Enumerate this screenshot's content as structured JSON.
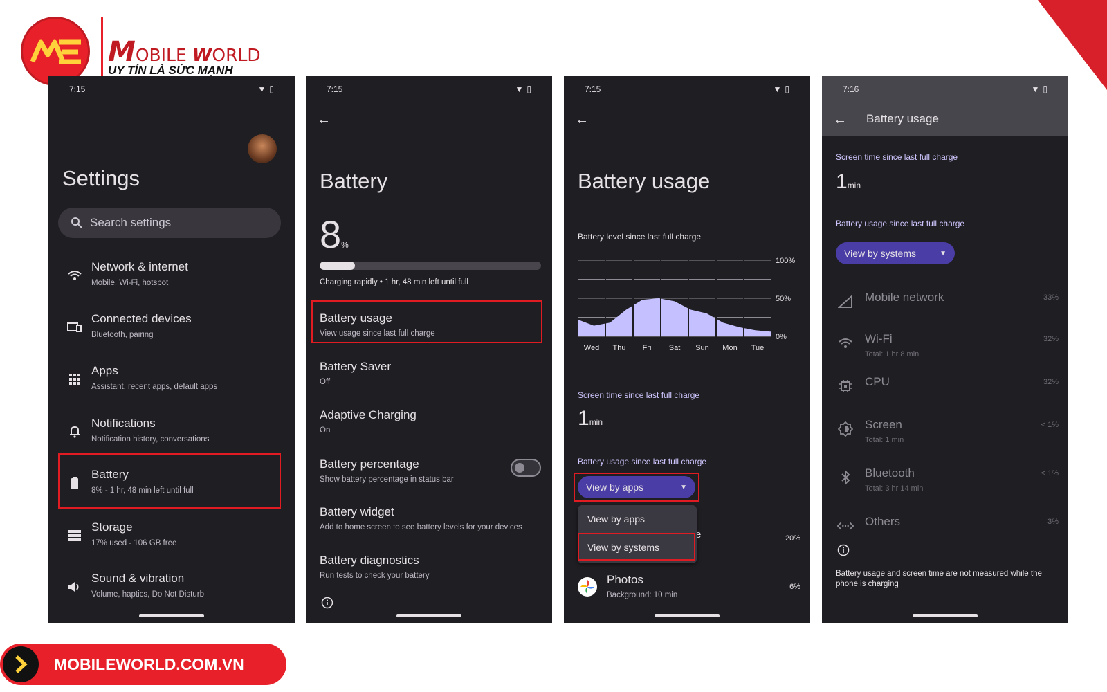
{
  "brand": {
    "name_big": "M",
    "name_rest": "OBILE",
    "name_big2": "W",
    "name_rest2": "ORLD",
    "tagline": "UY TÍN LÀ SỨC MẠNH",
    "website": "MOBILEWORLD.COM.VN",
    "colors": {
      "red": "#e8202a",
      "dark_red": "#c01b22"
    }
  },
  "screen1": {
    "time": "7:15",
    "title": "Settings",
    "search_placeholder": "Search settings",
    "items": [
      {
        "icon": "wifi-icon",
        "title": "Network & internet",
        "subtitle": "Mobile, Wi-Fi, hotspot"
      },
      {
        "icon": "devices-icon",
        "title": "Connected devices",
        "subtitle": "Bluetooth, pairing"
      },
      {
        "icon": "apps-grid-icon",
        "title": "Apps",
        "subtitle": "Assistant, recent apps, default apps"
      },
      {
        "icon": "bell-icon",
        "title": "Notifications",
        "subtitle": "Notification history, conversations"
      },
      {
        "icon": "battery-icon",
        "title": "Battery",
        "subtitle": "8% - 1 hr, 48 min left until full"
      },
      {
        "icon": "storage-icon",
        "title": "Storage",
        "subtitle": "17% used - 106 GB free"
      },
      {
        "icon": "speaker-icon",
        "title": "Sound & vibration",
        "subtitle": "Volume, haptics, Do Not Disturb"
      }
    ]
  },
  "screen2": {
    "time": "7:15",
    "title": "Battery",
    "percent": "8",
    "percent_unit": "%",
    "level_fraction": 0.08,
    "charging_text": "Charging rapidly • 1 hr, 48 min left until full",
    "items": [
      {
        "title": "Battery usage",
        "subtitle": "View usage since last full charge"
      },
      {
        "title": "Battery Saver",
        "subtitle": "Off"
      },
      {
        "title": "Adaptive Charging",
        "subtitle": "On"
      },
      {
        "title": "Battery percentage",
        "subtitle": "Show battery percentage in status bar"
      },
      {
        "title": "Battery widget",
        "subtitle": "Add to home screen to see battery levels for your devices"
      },
      {
        "title": "Battery diagnostics",
        "subtitle": "Run tests to check your battery"
      }
    ],
    "toggle_on": false
  },
  "screen3": {
    "time": "7:15",
    "title": "Battery usage",
    "chart_label": "Battery level since last full charge",
    "screen_time_label": "Screen time since last full charge",
    "screen_time_value": "1",
    "screen_time_unit": "min",
    "usage_label": "Battery usage since last full charge",
    "dropdown_selected": "View by apps",
    "dropdown_options": [
      "View by apps",
      "View by systems"
    ],
    "hidden_row_fragment": "e",
    "hidden_row_percent": "20%",
    "app_row": {
      "name": "Photos",
      "subtitle": "Background: 10 min",
      "percent": "6%"
    }
  },
  "chart_data": {
    "type": "area",
    "categories": [
      "Wed",
      "Thu",
      "Fri",
      "Sat",
      "Sun",
      "Mon",
      "Tue"
    ],
    "series": [
      {
        "values": [
          22,
          14,
          18,
          35,
          48,
          50,
          46,
          35,
          30,
          18,
          12,
          8,
          6
        ]
      }
    ],
    "ylim": [
      0,
      100
    ],
    "yticks": [
      "100%",
      "50%",
      "0%"
    ],
    "color": "#c5c0ff",
    "grid": true
  },
  "screen4": {
    "time": "7:16",
    "title": "Battery usage",
    "screen_time_label": "Screen time since last full charge",
    "screen_time_value": "1",
    "screen_time_unit": "min",
    "usage_label": "Battery usage since last full charge",
    "dropdown_selected": "View by systems",
    "categories": [
      {
        "icon": "signal-icon",
        "name": "Mobile network",
        "subtitle": "",
        "percent": "33%"
      },
      {
        "icon": "wifi-icon",
        "name": "Wi-Fi",
        "subtitle": "Total: 1 hr 8 min",
        "percent": "32%"
      },
      {
        "icon": "cpu-icon",
        "name": "CPU",
        "subtitle": "",
        "percent": "32%"
      },
      {
        "icon": "brightness-icon",
        "name": "Screen",
        "subtitle": "Total: 1 min",
        "percent": "< 1%"
      },
      {
        "icon": "bluetooth-icon",
        "name": "Bluetooth",
        "subtitle": "Total: 3 hr 14 min",
        "percent": "< 1%"
      },
      {
        "icon": "others-icon",
        "name": "Others",
        "subtitle": "",
        "percent": "3%"
      }
    ],
    "footnote": "Battery usage and screen time are not measured while the phone is charging"
  }
}
